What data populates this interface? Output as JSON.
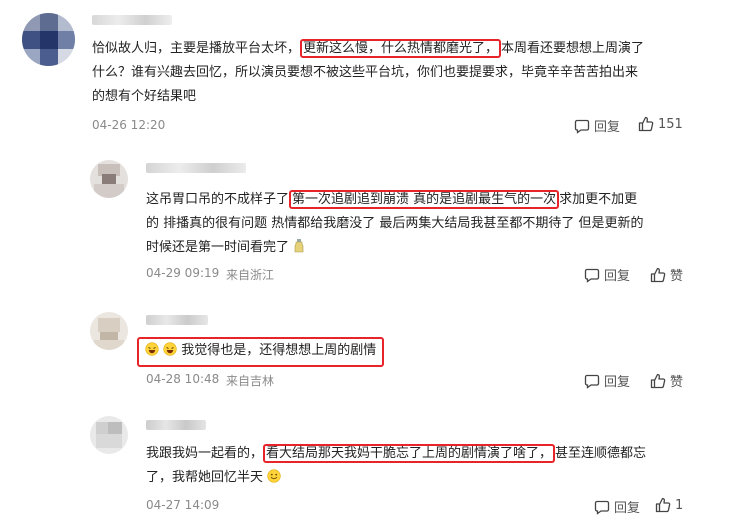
{
  "comments": [
    {
      "before": "恰似故人归，主要是播放平台太坏，",
      "highlight": "更新这么慢，什么热情都磨光了，",
      "after": "本周看还要想想上周演了",
      "line2": "什么？谁有兴趣去回忆，所以演员要想不被这些平台坑，你们也要提要求，毕竟辛辛苦苦拍出来",
      "line3": "的想有个好结果吧",
      "time": "04-26 12:20",
      "location": "",
      "reply_label": "回复",
      "like_label": "151"
    },
    {
      "before": "这吊胃口吊的不成样子了",
      "highlight": "第一次追剧追到崩溃 真的是追剧最生气的一次",
      "after": "求加更不加更",
      "line2": "的 排播真的很有问题 热情都给我磨没了 最后两集大结局我甚至都不期待了 但是更新的",
      "line3": "时候还是第一时间看完了",
      "time": "04-29 09:19",
      "location": "来自浙江",
      "reply_label": "回复",
      "like_label": "赞"
    },
    {
      "highlight": "我觉得也是，还得想想上周的剧情",
      "time": "04-28 10:48",
      "location": "来自吉林",
      "reply_label": "回复",
      "like_label": "赞"
    },
    {
      "before": "我跟我妈一起看的，",
      "highlight": "看大结局那天我妈干脆忘了上周的剧情演了啥了，",
      "after": "甚至连顺德都忘",
      "line2": "了，我帮她回忆半天",
      "time": "04-27 14:09",
      "location": "",
      "reply_label": "回复",
      "like_label": "1"
    }
  ],
  "colors": {
    "highlight_border": "#e8242b",
    "meta": "#8a8a8a"
  }
}
